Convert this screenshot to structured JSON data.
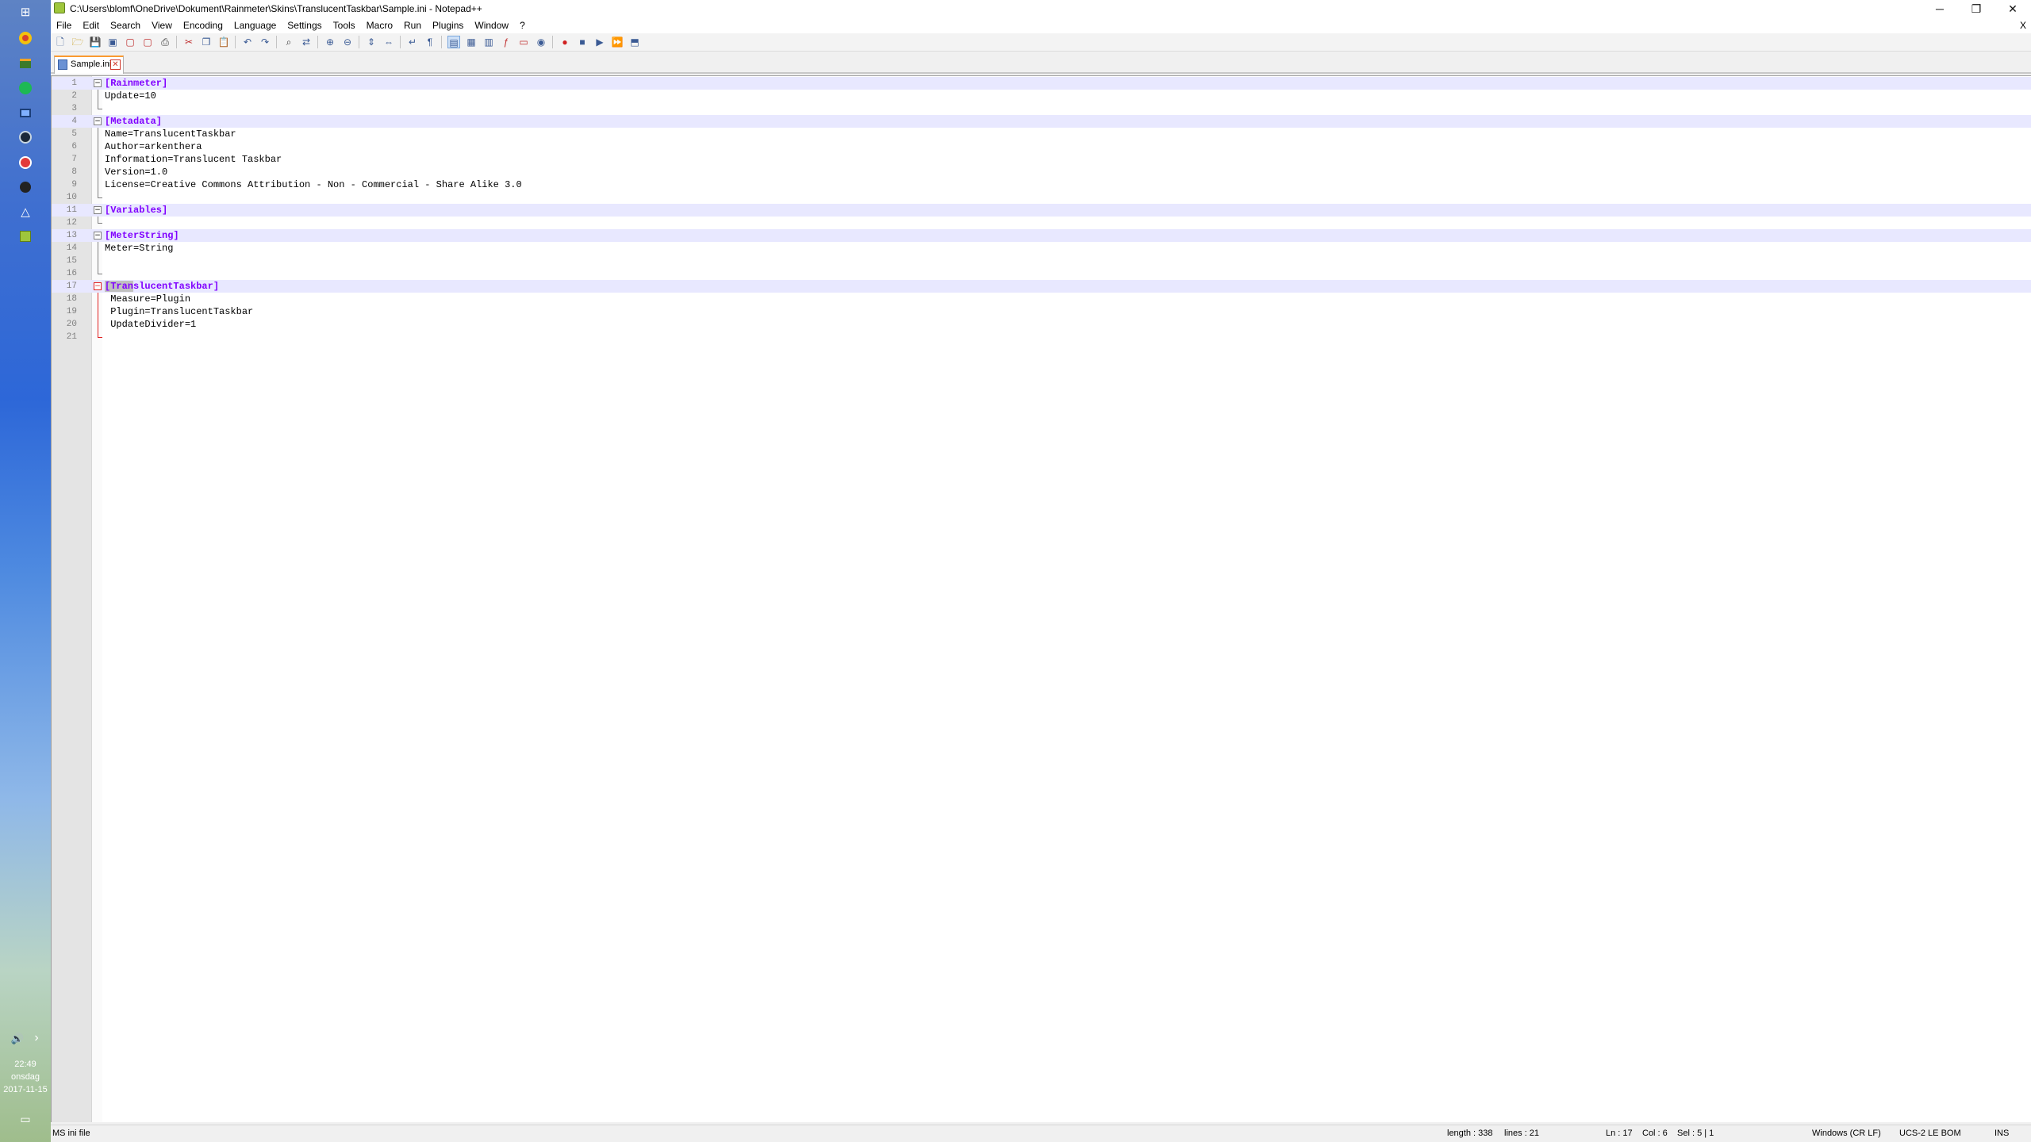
{
  "taskbar": {
    "icons": [
      "windows-start-icon",
      "chrome-icon",
      "store-icon",
      "spotify-icon",
      "monitor-icon",
      "steam-icon",
      "app-red-icon",
      "app-dark-icon",
      "triangle-app-icon",
      "notepadpp-icon"
    ],
    "tray": {
      "volume": "🔊",
      "chevron": "›"
    },
    "clock": {
      "time": "22:49",
      "day": "onsdag",
      "date": "2017-11-15"
    }
  },
  "window": {
    "title": "C:\\Users\\blomf\\OneDrive\\Dokument\\Rainmeter\\Skins\\TranslucentTaskbar\\Sample.ini - Notepad++",
    "buttons": {
      "minimize": "─",
      "restore": "❐",
      "close": "✕"
    }
  },
  "menu": {
    "items": [
      "File",
      "Edit",
      "Search",
      "View",
      "Encoding",
      "Language",
      "Settings",
      "Tools",
      "Macro",
      "Run",
      "Plugins",
      "Window",
      "?"
    ],
    "close_doc": "X"
  },
  "tab": {
    "label": "Sample.ini",
    "close": "✕"
  },
  "editor": {
    "lines": [
      {
        "n": "1",
        "text": "[Rainmeter]",
        "section": true,
        "fold": "open"
      },
      {
        "n": "2",
        "text": "Update=10",
        "fold": "line"
      },
      {
        "n": "3",
        "text": "",
        "fold": "end"
      },
      {
        "n": "4",
        "text": "[Metadata]",
        "section": true,
        "fold": "open"
      },
      {
        "n": "5",
        "text": "Name=TranslucentTaskbar",
        "fold": "line"
      },
      {
        "n": "6",
        "text": "Author=arkenthera",
        "fold": "line"
      },
      {
        "n": "7",
        "text": "Information=Translucent Taskbar",
        "fold": "line"
      },
      {
        "n": "8",
        "text": "Version=1.0",
        "fold": "line"
      },
      {
        "n": "9",
        "text": "License=Creative Commons Attribution - Non - Commercial - Share Alike 3.0",
        "fold": "line"
      },
      {
        "n": "10",
        "text": "",
        "fold": "end"
      },
      {
        "n": "11",
        "text": "[Variables]",
        "section": true,
        "fold": "open"
      },
      {
        "n": "12",
        "text": "",
        "fold": "end"
      },
      {
        "n": "13",
        "text": "[MeterString]",
        "section": true,
        "fold": "open"
      },
      {
        "n": "14",
        "text": "Meter=String",
        "fold": "line"
      },
      {
        "n": "15",
        "text": "",
        "fold": "line"
      },
      {
        "n": "16",
        "text": "",
        "fold": "end"
      },
      {
        "n": "17",
        "text": "[TranslucentTaskbar]",
        "section": true,
        "fold": "open-red",
        "current": true
      },
      {
        "n": "18",
        "text": " Measure=Plugin",
        "fold": "line-red"
      },
      {
        "n": "19",
        "text": " Plugin=TranslucentTaskbar",
        "fold": "line-red"
      },
      {
        "n": "20",
        "text": " UpdateDivider=1",
        "fold": "line-red"
      },
      {
        "n": "21",
        "text": "",
        "fold": "end-red"
      }
    ]
  },
  "status": {
    "filetype": "MS ini file",
    "length": "length : 338",
    "lines": "lines : 21",
    "ln": "Ln : 17",
    "col": "Col : 6",
    "sel": "Sel : 5 | 1",
    "eol": "Windows (CR LF)",
    "encoding": "UCS-2 LE BOM",
    "mode": "INS"
  },
  "colors": {
    "section": "#8000ff",
    "current_line": "#e8e8ff",
    "tab_accent": "#fa9a30",
    "fold_active": "#e02020"
  }
}
